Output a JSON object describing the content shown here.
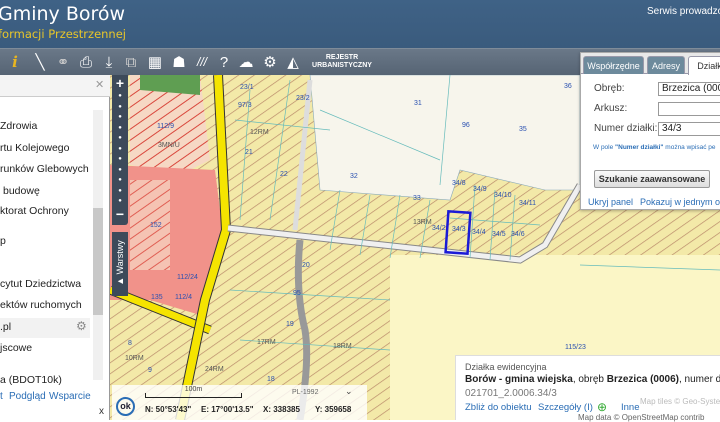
{
  "header": {
    "title": "Gminy Borów",
    "subtitle": "formacji Przestrzennej",
    "service": "Serwis prowadzon"
  },
  "toolbar": {
    "icons": [
      "info-icon",
      "measure-icon",
      "link-icon",
      "print-icon",
      "download-icon",
      "overlay-icon",
      "layout-icon",
      "shape-icon",
      "hatch-icon",
      "help-icon",
      "cloud-icon",
      "settings-icon",
      "triangle-icon"
    ],
    "rejestr_line1": "REJESTR",
    "rejestr_line2": "URBANISTYCZNY"
  },
  "left_panel": {
    "items": [
      "Zdrowia",
      "rtu Kolejowego",
      "runków Glebowych",
      "budowę",
      "ktorat Ochrony",
      "p",
      "cytut Dziedzictwa",
      "ektów ruchomych",
      ".pl",
      "jscowe",
      "a (BDOT10k)"
    ],
    "footer": {
      "prefix": "t",
      "preview": "Podgląd",
      "support": "Wsparcie",
      "close": "x"
    }
  },
  "map": {
    "layers_button": "Warstwy",
    "labels": [
      "23/1",
      "23/2",
      "97/3",
      "12RM",
      "21",
      "22",
      "31",
      "96",
      "35",
      "36",
      "32",
      "33",
      "34/8",
      "34/9",
      "34/10",
      "34/11",
      "13RM",
      "34/2",
      "34/3",
      "34/4",
      "34/5",
      "34/6",
      "112/9",
      "3MN/U",
      "152",
      "112/24",
      "112/4",
      "135",
      "20",
      "95",
      "19",
      "17RM",
      "18RM",
      "115/23",
      "8",
      "10RM",
      "24RM",
      "18",
      "9"
    ],
    "selected_parcel": "34/3",
    "selection_color": "#1a1ad6",
    "scale": "100m",
    "crs": "PL-1992",
    "ok_label": "ok",
    "coords": {
      "n": "N: 50°53'43\"",
      "e": "E: 17°00'13.5\"",
      "x": "X: 338385",
      "y": "Y: 359658"
    },
    "attribution_tiles": "Map tiles © Geo-Syste",
    "attribution_data": "Map data © OpenStreetMap contrib"
  },
  "search_panel": {
    "tabs": [
      "Współrzędne",
      "Adresy",
      "Działki"
    ],
    "active_tab": "Działki",
    "obreb_label": "Obręb:",
    "obreb_value": "Brzezica (0006)",
    "arkusz_label": "Arkusz:",
    "arkusz_value": "",
    "numer_label": "Numer działki:",
    "numer_value": "34/3",
    "hint_prefix": "W pole ",
    "hint_bold": "\"Numer działki\"",
    "hint_rest": " można wpisać pe",
    "advanced_button": "Szukanie zaawansowane",
    "hide_panel": "Ukryj panel",
    "show_one_window": "Pokazuj w jednym okni"
  },
  "info_box": {
    "type": "Działka ewidencyjna",
    "gmina": "Borów - gmina wiejska",
    "obreb_prefix": ", obręb ",
    "obreb": "Brzezica (0006)",
    "suffix": ", numer dz.",
    "id": "021701_2.0006.34/3",
    "zoom_link": "Zbliż do obiektu",
    "details_link": "Szczegóły (I)",
    "other_link": "Inne"
  }
}
